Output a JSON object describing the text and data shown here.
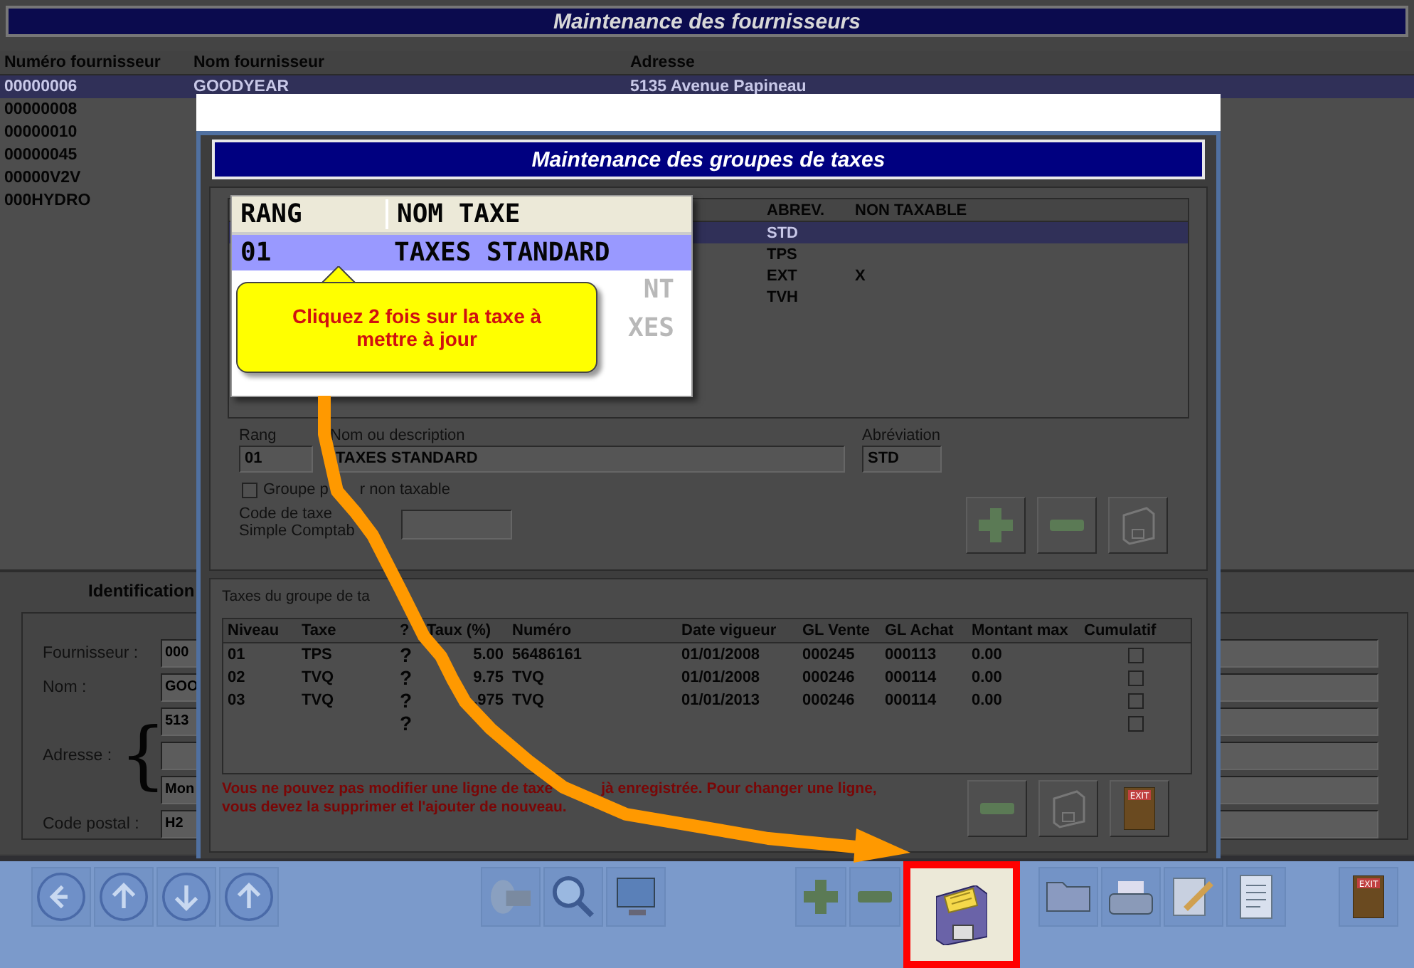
{
  "main_window": {
    "title": "Maintenance des fournisseurs"
  },
  "supplier_list": {
    "columns": [
      "Numéro fournisseur",
      "Nom fournisseur",
      "Adresse"
    ],
    "rows": [
      {
        "number": "00000006",
        "name": "GOODYEAR",
        "address": "5135 Avenue Papineau",
        "selected": true
      },
      {
        "number": "00000008",
        "selected": false
      },
      {
        "number": "00000010",
        "selected": false
      },
      {
        "number": "00000045",
        "selected": false
      },
      {
        "number": "00000V2V",
        "selected": false
      },
      {
        "number": "000HYDRO",
        "selected": false
      }
    ]
  },
  "identification": {
    "tab": "Identification",
    "fields": [
      {
        "kind": "single",
        "label": "Fournisseur :",
        "lines": [
          {
            "kind": "text",
            "value": "000"
          }
        ]
      },
      {
        "kind": "single",
        "label": "Nom :",
        "lines": [
          {
            "kind": "text",
            "value": "GOO"
          }
        ]
      },
      {
        "kind": "address",
        "label": "Adresse :",
        "brace": "{",
        "lines": [
          {
            "kind": "text",
            "value": "513"
          },
          {
            "kind": "blank"
          },
          {
            "kind": "text",
            "value": "Mon"
          }
        ]
      },
      {
        "kind": "single",
        "label": "Code postal :",
        "lines": [
          {
            "kind": "text",
            "value": "H2"
          }
        ]
      }
    ]
  },
  "tax_groups_dialog": {
    "title": "Maintenance des groupes de taxes",
    "groups_table": {
      "columns": [
        "ABREV.",
        "NON TAXABLE"
      ],
      "rows": [
        {
          "abbrev": "STD",
          "selected": true
        },
        {
          "abbrev": "TPS",
          "selected": false
        },
        {
          "abbrev": "EXT",
          "non_taxable": "X",
          "selected": false
        },
        {
          "abbrev": "TVH",
          "selected": false
        }
      ]
    },
    "zoom_callout": {
      "columns": [
        "RANG",
        "NOM TAXE"
      ],
      "rows": [
        {
          "rang": "01",
          "name": "TAXES STANDARD",
          "selected": true
        },
        {
          "name": "NT",
          "selected": false
        },
        {
          "name": "XES",
          "selected": false
        }
      ],
      "tooltip": "Cliquez 2 fois sur la taxe à mettre à jour"
    },
    "form": {
      "rang_label": "Rang",
      "rang": "01",
      "description_label": "Nom ou description",
      "description": "TAXES STANDARD",
      "abbrev_label": "Abréviation",
      "abbrev": "STD",
      "non_taxable_checkbox": {
        "label_parts": [
          "Groupe p",
          "r non taxable"
        ],
        "checked": false
      },
      "tax_code_label": [
        "Code de taxe",
        "Simple Comptab"
      ]
    },
    "group_buttons": [
      {
        "kind": "add"
      },
      {
        "kind": "remove"
      },
      {
        "kind": "save"
      }
    ],
    "taxes_panel": {
      "title": "Taxes du groupe de ta",
      "columns": [
        "Niveau",
        "Taxe",
        "?",
        "Taux (%)",
        "Numéro",
        "Date vigueur",
        "GL Vente",
        "GL Achat",
        "Montant max",
        "Cumulatif"
      ],
      "rows": [
        {
          "niveau": "01",
          "taxe": "TPS",
          "info": "?",
          "taux": "5.00",
          "numero": "56486161",
          "date": "01/01/2008",
          "gl_vente": "000245",
          "gl_achat": "000113",
          "montant_max": "0.00",
          "cumulatif": false
        },
        {
          "niveau": "02",
          "taxe": "TVQ",
          "info": "?",
          "taux": "9.75",
          "numero": "TVQ",
          "date": "01/01/2008",
          "gl_vente": "000246",
          "gl_achat": "000114",
          "montant_max": "0.00",
          "cumulatif": false
        },
        {
          "niveau": "03",
          "taxe": "TVQ",
          "info": "?",
          "taux": ".975",
          "numero": "TVQ",
          "date": "01/01/2013",
          "gl_vente": "000246",
          "gl_achat": "000114",
          "montant_max": "0.00",
          "cumulatif": false
        },
        {
          "info": "?",
          "cumulatif": false
        }
      ],
      "message_lines": [
        [
          "Vous ne pouvez pas modifier une ligne de taxe",
          "jà enregistrée. Pour changer une ligne,"
        ],
        [
          "vous devez la supprimer et l'ajouter de nouveau."
        ]
      ],
      "buttons": [
        {
          "kind": "remove"
        },
        {
          "kind": "save"
        },
        {
          "kind": "exit",
          "label": "EXIT"
        }
      ]
    }
  },
  "toolbar": {
    "groups": [
      {
        "buttons": [
          {
            "kind": "first",
            "highlighted": false
          },
          {
            "kind": "previous",
            "highlighted": false
          },
          {
            "kind": "next",
            "highlighted": false
          },
          {
            "kind": "last",
            "highlighted": false
          }
        ]
      },
      {
        "buttons": [
          {
            "kind": "search",
            "highlighted": false
          },
          {
            "kind": "zoom",
            "highlighted": false
          },
          {
            "kind": "screen",
            "highlighted": false
          }
        ]
      },
      {
        "buttons": [
          {
            "kind": "add",
            "highlighted": false
          },
          {
            "kind": "remove",
            "highlighted": false
          },
          {
            "kind": "save",
            "highlighted": true
          }
        ]
      },
      {
        "buttons": [
          {
            "kind": "folder",
            "highlighted": false
          },
          {
            "kind": "print",
            "highlighted": false
          },
          {
            "kind": "edit",
            "highlighted": false
          },
          {
            "kind": "document",
            "highlighted": false
          }
        ]
      },
      {
        "buttons": [
          {
            "kind": "exit",
            "label": "EXIT",
            "highlighted": false
          }
        ]
      }
    ]
  }
}
